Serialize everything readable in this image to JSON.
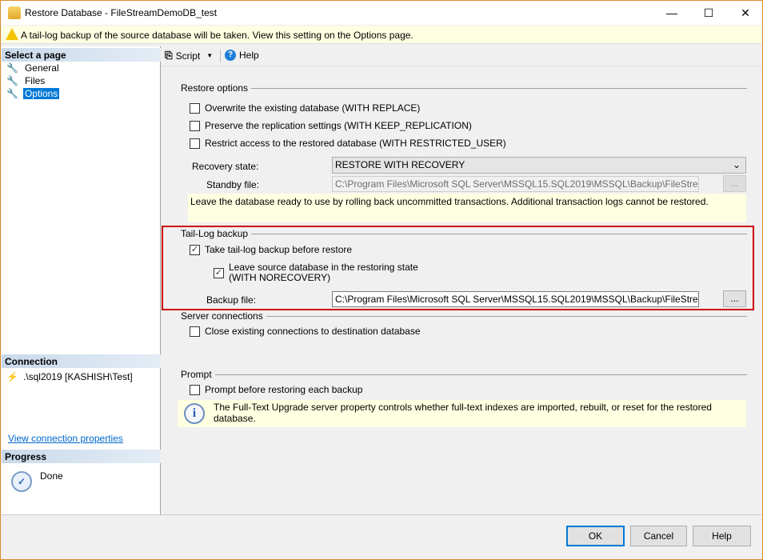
{
  "window": {
    "title": "Restore Database - FileStreamDemoDB_test",
    "minimize": "—",
    "maximize": "☐",
    "close": "✕"
  },
  "warning": "A tail-log backup of the source database will be taken. View this setting on the Options page.",
  "left": {
    "select_header": "Select a page",
    "pages": [
      {
        "label": "General"
      },
      {
        "label": "Files"
      },
      {
        "label": "Options"
      }
    ],
    "connection_header": "Connection",
    "connection": ".\\sql2019 [KASHISH\\Test]",
    "view_connection": "View connection properties",
    "progress_header": "Progress",
    "progress_status": "Done"
  },
  "toolbar": {
    "script": "Script",
    "help": "Help"
  },
  "restore_options": {
    "title": "Restore options",
    "overwrite": "Overwrite the existing database (WITH REPLACE)",
    "preserve": "Preserve the replication settings (WITH KEEP_REPLICATION)",
    "restrict": "Restrict access to the restored database (WITH RESTRICTED_USER)",
    "recovery_label": "Recovery state:",
    "recovery_value": "RESTORE WITH RECOVERY",
    "standby_label": "Standby file:",
    "standby_value": "C:\\Program Files\\Microsoft SQL Server\\MSSQL15.SQL2019\\MSSQL\\Backup\\FileStreamDemo",
    "browse": "...",
    "note": "Leave the database ready to use by rolling back uncommitted transactions. Additional transaction logs cannot be restored."
  },
  "tail_log": {
    "title": "Tail-Log backup",
    "take": "Take tail-log backup before restore",
    "leave_line1": "Leave source database in the restoring state",
    "leave_line2": "(WITH NORECOVERY)",
    "backup_label": "Backup file:",
    "backup_value": "C:\\Program Files\\Microsoft SQL Server\\MSSQL15.SQL2019\\MSSQL\\Backup\\FileStreamDemo",
    "browse": "..."
  },
  "server": {
    "title": "Server connections",
    "close": "Close existing connections to destination database"
  },
  "prompt": {
    "title": "Prompt",
    "prompt_before": "Prompt before restoring each backup",
    "info": "The Full-Text Upgrade server property controls whether full-text indexes are imported, rebuilt, or reset for the restored database."
  },
  "buttons": {
    "ok": "OK",
    "cancel": "Cancel",
    "help": "Help"
  },
  "colors": {
    "highlight": "#cc0000",
    "selection": "#0078d7",
    "note": "#ffffe1"
  }
}
